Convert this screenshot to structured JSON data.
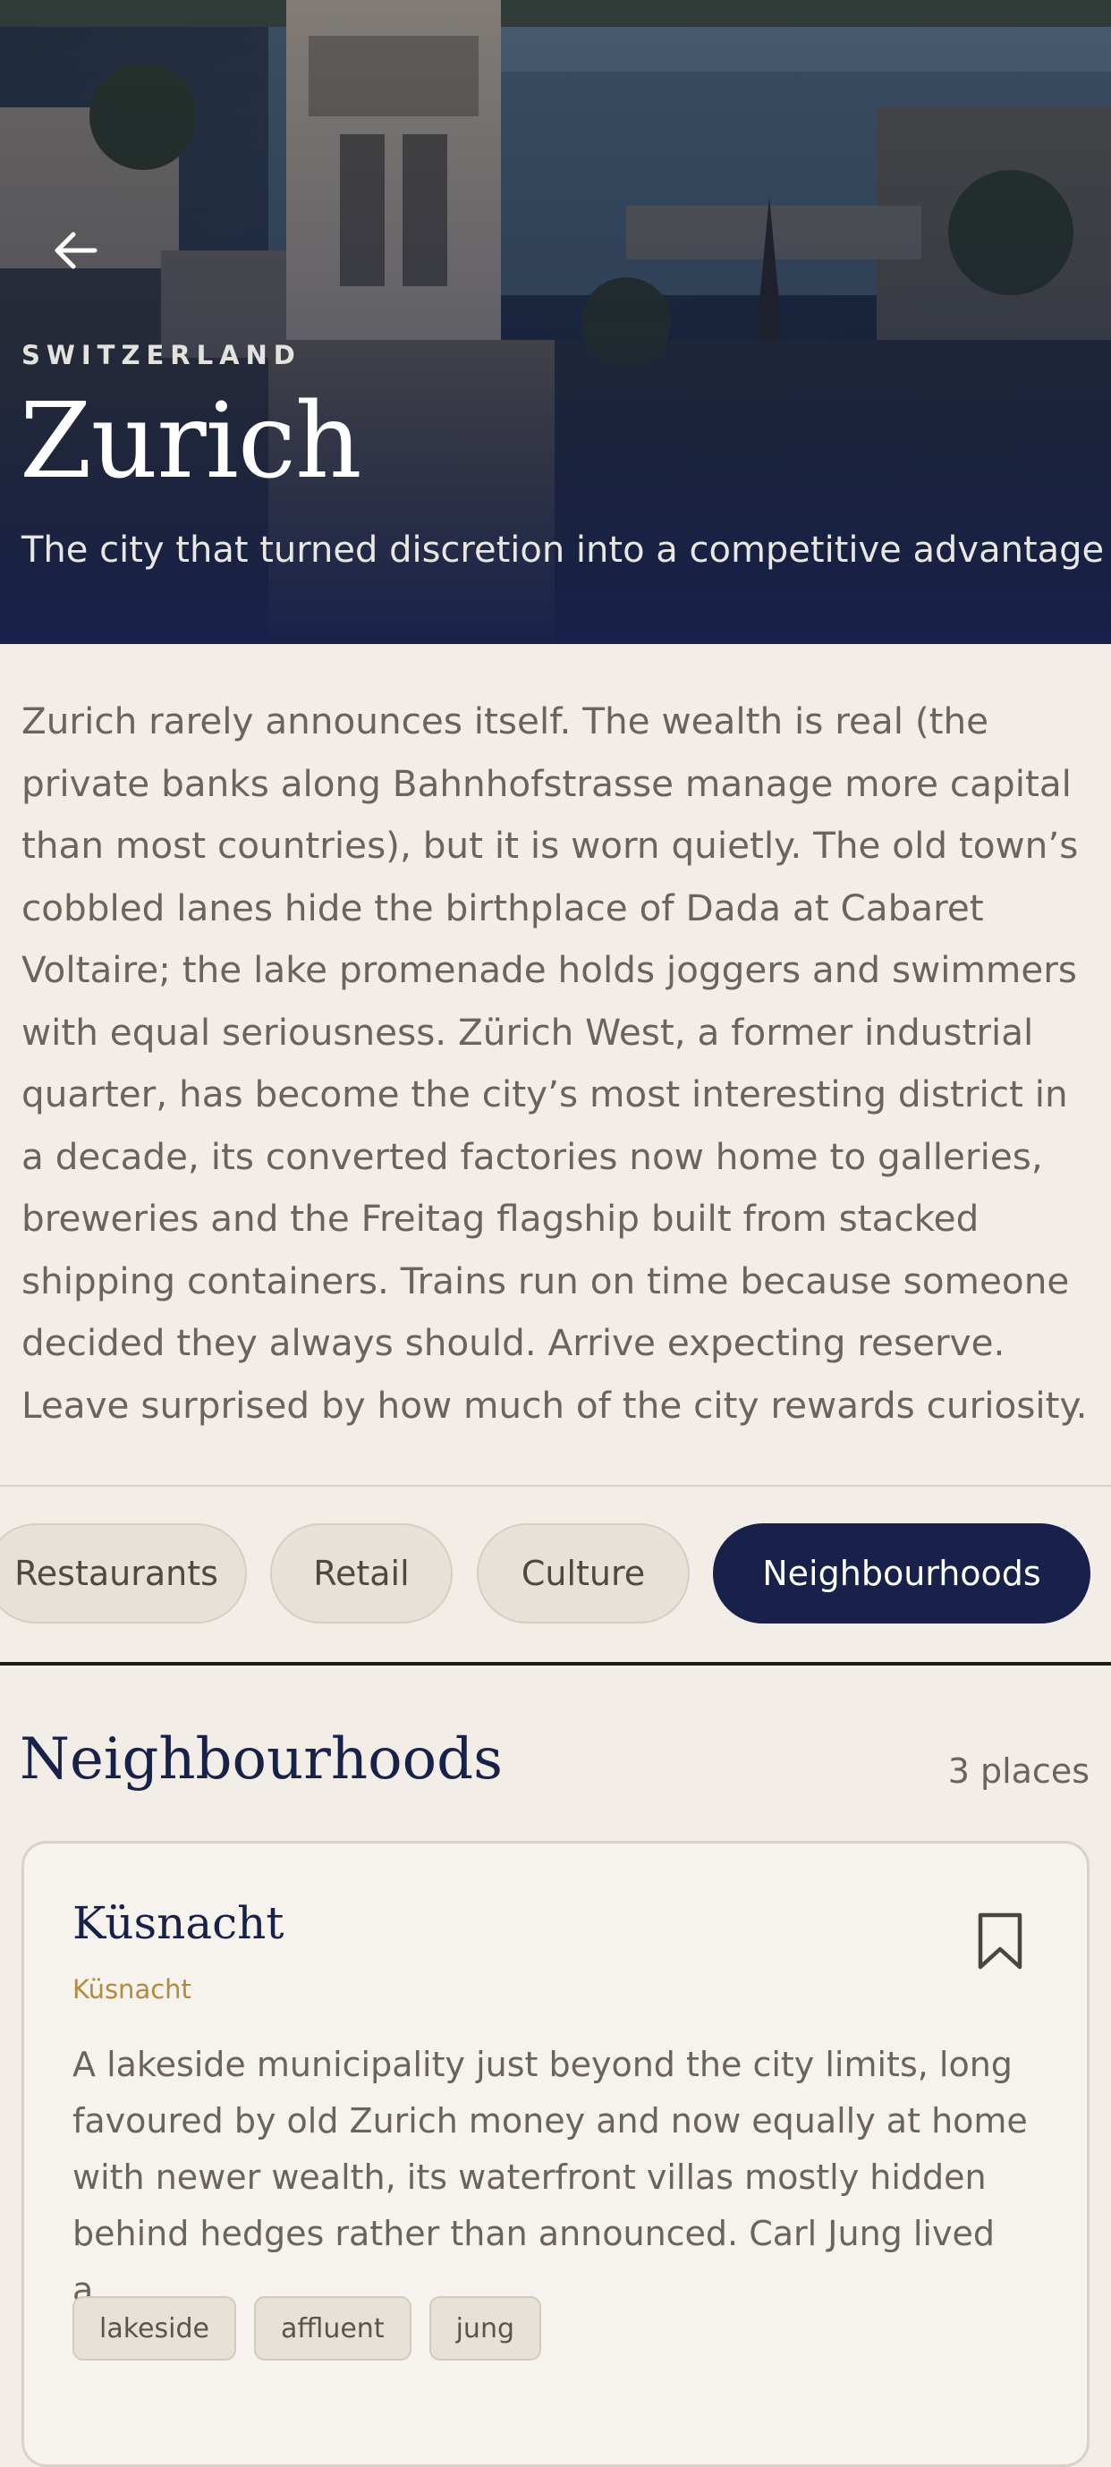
{
  "hero": {
    "eyebrow": "SWITZERLAND",
    "title": "Zurich",
    "tagline": "The city that turned discretion into a competitive advantage",
    "back_icon": "arrow-left-icon"
  },
  "intro": "Zurich rarely announces itself. The wealth is real (the private banks along Bahnhofstrasse manage more capital than most countries), but it is worn quietly. The old town’s cobbled lanes hide the birthplace of Dada at Cabaret Voltaire; the lake promenade holds joggers and swimmers with equal seriousness. Zürich West, a former industrial quarter, has become the city’s most interesting district in a decade, its converted factories now home to galleries, breweries and the Freitag flagship built from stacked shipping containers. Trains run on time because someone decided they always should. Arrive expecting reserve. Leave surprised by how much of the city rewards curiosity.",
  "tabs": [
    {
      "label": "Restaurants",
      "active": false
    },
    {
      "label": "Retail",
      "active": false
    },
    {
      "label": "Culture",
      "active": false
    },
    {
      "label": "Neighbourhoods",
      "active": true
    }
  ],
  "section": {
    "title": "Neighbourhoods",
    "count": "3 places"
  },
  "card": {
    "title": "Küsnacht",
    "subtitle": "Küsnacht",
    "description": "A lakeside municipality just beyond the city limits, long favoured by old Zurich money and now equally at home with newer wealth, its waterfront villas mostly hidden behind hedges rather than announced. Carl Jung lived a...",
    "bookmark_icon": "bookmark-icon",
    "tags": [
      "lakeside",
      "affluent",
      "jung"
    ]
  },
  "colors": {
    "navy": "#18214a",
    "background": "#f2ede6",
    "accent_gold": "#b48a3c"
  }
}
